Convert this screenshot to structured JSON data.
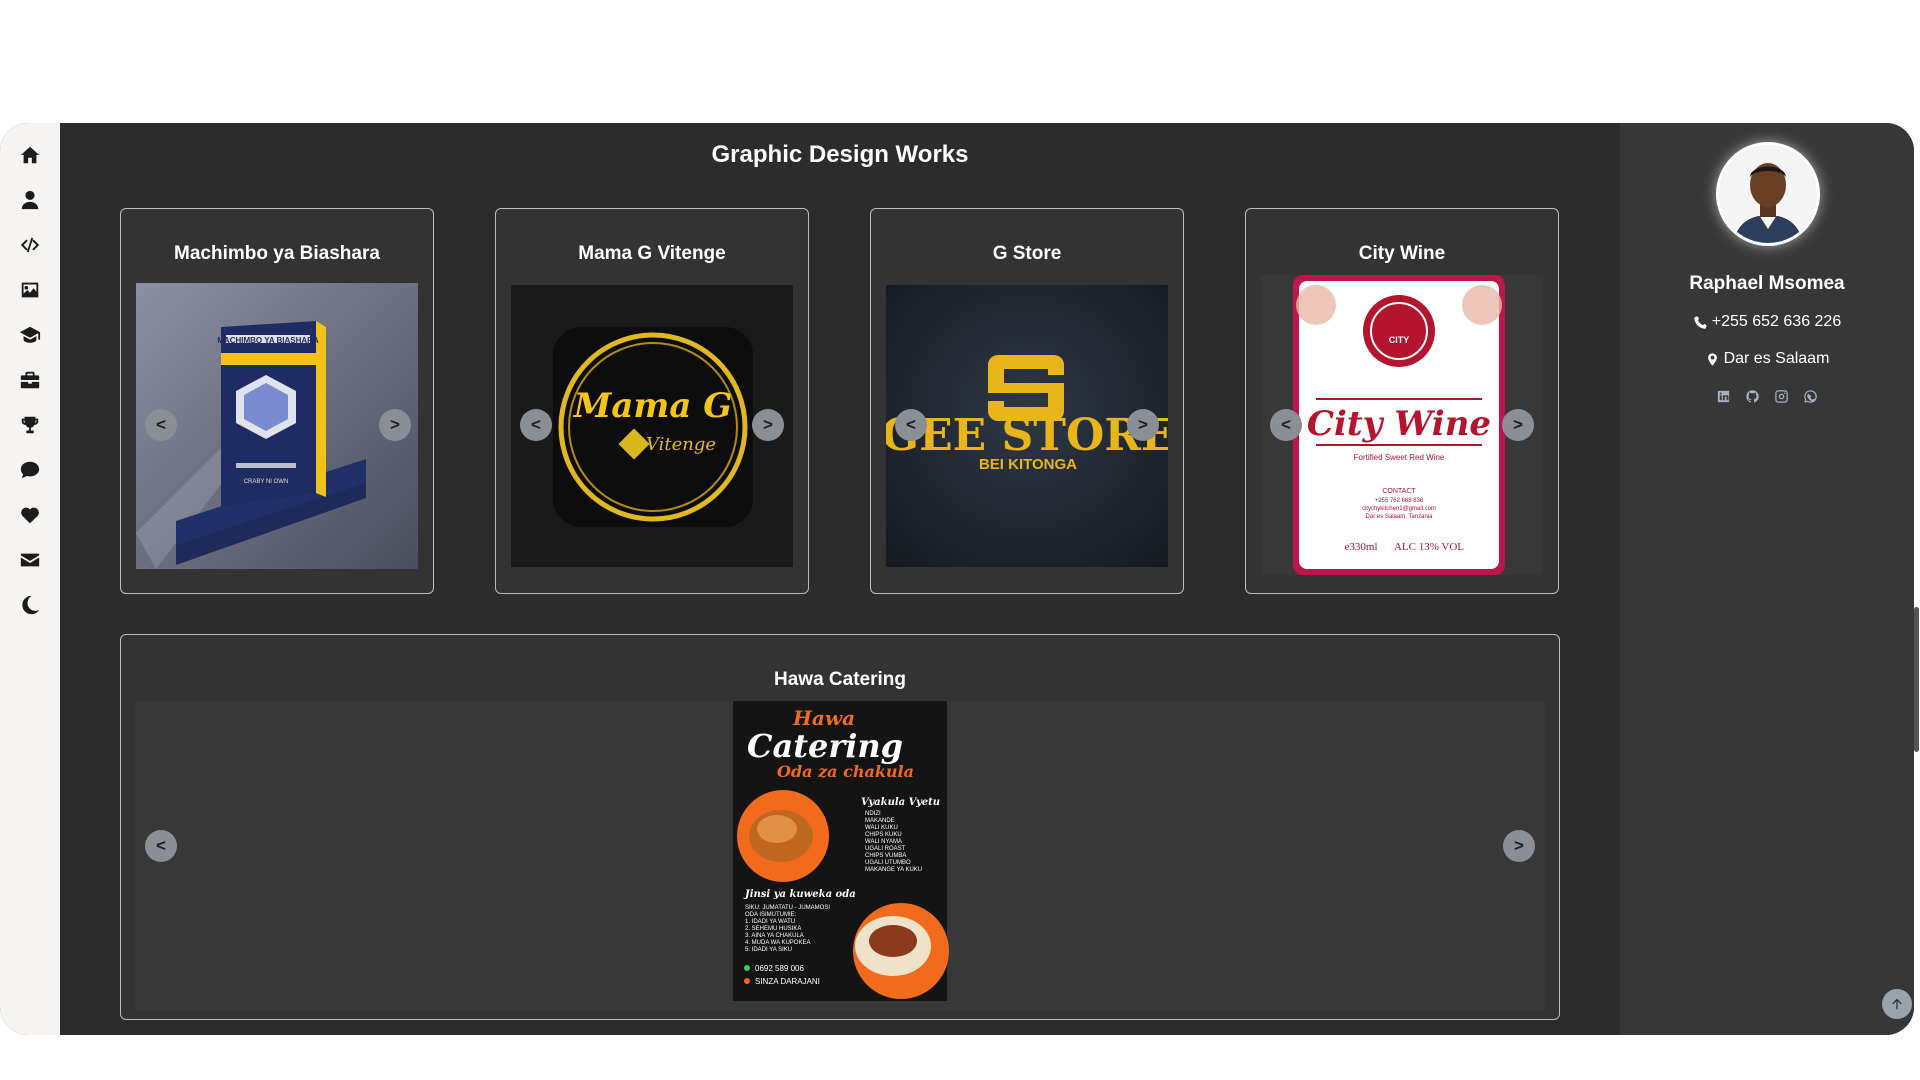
{
  "nav": {
    "items": [
      "home-icon",
      "user-icon",
      "code-icon",
      "image-icon",
      "graduation-cap-icon",
      "briefcase-icon",
      "trophy-icon",
      "chat-icon",
      "heart-icon",
      "envelope-icon",
      "moon-icon"
    ]
  },
  "section": {
    "title": "Graphic Design Works"
  },
  "cards": [
    {
      "title": "Machimbo ya Biashara",
      "prev": "<",
      "next": ">",
      "artwork": {
        "header": "MACHIMBO YA BIASHARA",
        "author": "CRABY NI OWN"
      }
    },
    {
      "title": "Mama G Vitenge",
      "prev": "<",
      "next": ">",
      "artwork": {
        "brand": "Mama G",
        "sub": "Vitenge"
      }
    },
    {
      "title": "G Store",
      "prev": "<",
      "next": ">",
      "artwork": {
        "brand": "GEE STORE",
        "sub": "BEI KITONGA"
      }
    },
    {
      "title": "City Wine",
      "prev": "<",
      "next": ">",
      "artwork": {
        "badge": "CITY",
        "brand": "City Wine",
        "sub": "Fortified Sweet Red Wine",
        "contact_head": "CONTACT",
        "phone": "+255 762 668 836",
        "email": "citychykitchen1@gmail.com",
        "place": "Dar es Salaam, Tanzania",
        "volume": "e330ml",
        "alcohol": "ALC 13% VOL"
      }
    }
  ],
  "wide_card": {
    "title": "Hawa Catering",
    "prev": "<",
    "next": ">",
    "artwork": {
      "line1": "Hawa",
      "line2": "Catering",
      "line3": "Oda za chakula",
      "menu_head": "Vyakula Vyetu",
      "menu": [
        "NDIZI",
        "MAKANDE",
        "WALI KUKU",
        "CHIPS KUKU",
        "WALI NYAMA",
        "UGALI ROAST",
        "CHIPS VUMBA",
        "UGALI UTUMBO",
        "MAKANGE YA KUKU"
      ],
      "how_head": "Jinsi ya kuweka oda",
      "how": [
        "SIKU: JUMATATU - JUMAMOSI",
        "ODA ISIMUTUMIE:",
        "1. IDADI YA WATU",
        "2. SEHEMU HUSIKA",
        "3. AINA YA CHAKULA",
        "4. MUDA WA KUPOKEA",
        "5. IDADI YA SIKU"
      ],
      "phone": "0692 589 006",
      "location": "SINZA DARAJANI"
    }
  },
  "profile": {
    "name": "Raphael Msomea",
    "phone": "+255 652 636 226",
    "location": "Dar es Salaam",
    "socials": [
      "linkedin-icon",
      "github-icon",
      "instagram-icon",
      "whatsapp-icon"
    ]
  }
}
